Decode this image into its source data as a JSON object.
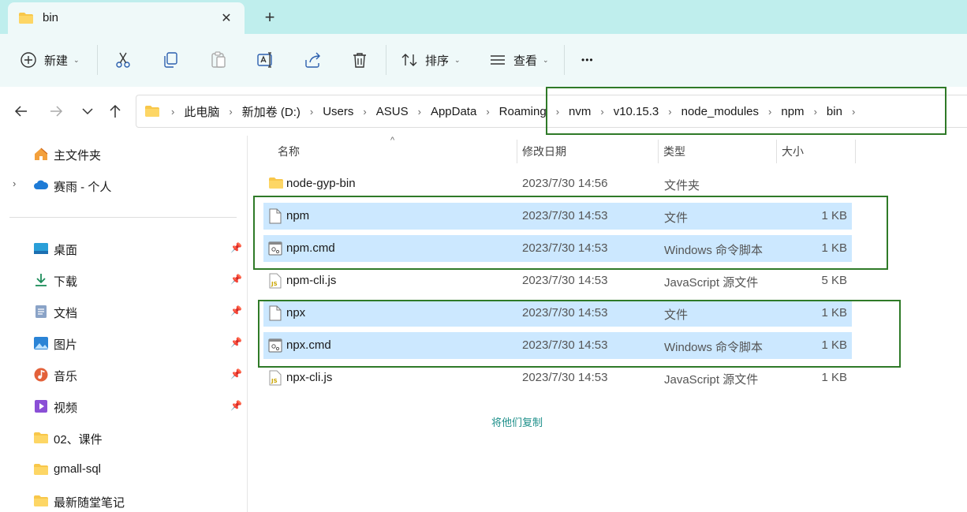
{
  "tab": {
    "title": "bin",
    "close": "✕",
    "new": "+"
  },
  "toolbar": {
    "new_label": "新建",
    "sort_label": "排序",
    "view_label": "查看",
    "more": "•••"
  },
  "breadcrumbs": [
    "此电脑",
    "新加卷 (D:)",
    "Users",
    "ASUS",
    "AppData",
    "Roaming",
    "nvm",
    "v10.15.3",
    "node_modules",
    "npm",
    "bin"
  ],
  "sidebar": {
    "top": [
      {
        "label": "主文件夹",
        "icon": "home-icon"
      },
      {
        "label": "赛雨 - 个人",
        "icon": "cloud-icon"
      }
    ],
    "pinned": [
      {
        "label": "桌面",
        "icon": "desktop-icon",
        "pinned": true
      },
      {
        "label": "下载",
        "icon": "download-icon",
        "pinned": true
      },
      {
        "label": "文档",
        "icon": "document-icon",
        "pinned": true
      },
      {
        "label": "图片",
        "icon": "pictures-icon",
        "pinned": true
      },
      {
        "label": "音乐",
        "icon": "music-icon",
        "pinned": true
      },
      {
        "label": "视频",
        "icon": "video-icon",
        "pinned": true
      },
      {
        "label": "02、课件",
        "icon": "folder-icon",
        "pinned": false
      },
      {
        "label": "gmall-sql",
        "icon": "folder-icon",
        "pinned": false
      },
      {
        "label": "最新随堂笔记",
        "icon": "folder-icon",
        "pinned": false
      }
    ]
  },
  "columns": {
    "name": "名称",
    "date": "修改日期",
    "type": "类型",
    "size": "大小"
  },
  "files": [
    {
      "name": "node-gyp-bin",
      "date": "2023/7/30 14:56",
      "type": "文件夹",
      "size": "",
      "icon": "folder-icon",
      "selected": false
    },
    {
      "name": "npm",
      "date": "2023/7/30 14:53",
      "type": "文件",
      "size": "1 KB",
      "icon": "file-icon",
      "selected": true
    },
    {
      "name": "npm.cmd",
      "date": "2023/7/30 14:53",
      "type": "Windows 命令脚本",
      "size": "1 KB",
      "icon": "cmd-file-icon",
      "selected": true
    },
    {
      "name": "npm-cli.js",
      "date": "2023/7/30 14:53",
      "type": "JavaScript 源文件",
      "size": "5 KB",
      "icon": "js-file-icon",
      "selected": false
    },
    {
      "name": "npx",
      "date": "2023/7/30 14:53",
      "type": "文件",
      "size": "1 KB",
      "icon": "file-icon",
      "selected": true
    },
    {
      "name": "npx.cmd",
      "date": "2023/7/30 14:53",
      "type": "Windows 命令脚本",
      "size": "1 KB",
      "icon": "cmd-file-icon",
      "selected": true
    },
    {
      "name": "npx-cli.js",
      "date": "2023/7/30 14:53",
      "type": "JavaScript 源文件",
      "size": "1 KB",
      "icon": "js-file-icon",
      "selected": false
    }
  ],
  "annotation": "将他们复制",
  "colors": {
    "highlight_box": "#2f7a28",
    "selection": "#cce8ff",
    "tabbar": "#bfeeed",
    "annotation": "#1d8f8a"
  }
}
